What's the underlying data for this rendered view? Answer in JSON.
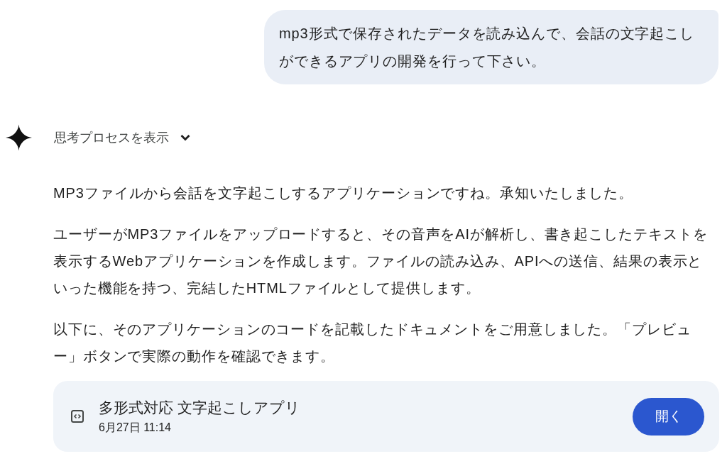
{
  "user_message": {
    "text": "mp3形式で保存されたデータを読み込んで、会話の文字起こしができるアプリの開発を行って下さい。"
  },
  "response": {
    "thoughts_toggle": {
      "label": "思考プロセスを表示",
      "expanded": false
    },
    "paragraphs": [
      "MP3ファイルから会話を文字起こしするアプリケーションですね。承知いたしました。",
      "ユーザーがMP3ファイルをアップロードすると、その音声をAIが解析し、書き起こしたテキストを表示するWebアプリケーションを作成します。ファイルの読み込み、APIへの送信、結果の表示といった機能を持つ、完結したHTMLファイルとして提供します。",
      "以下に、そのアプリケーションのコードを記載したドキュメントをご用意しました。「プレビュー」ボタンで実際の動作を確認できます。"
    ],
    "document_card": {
      "title": "多形式対応 文字起こしアプリ",
      "date": "6月27日 11:14",
      "button": "開く"
    }
  }
}
